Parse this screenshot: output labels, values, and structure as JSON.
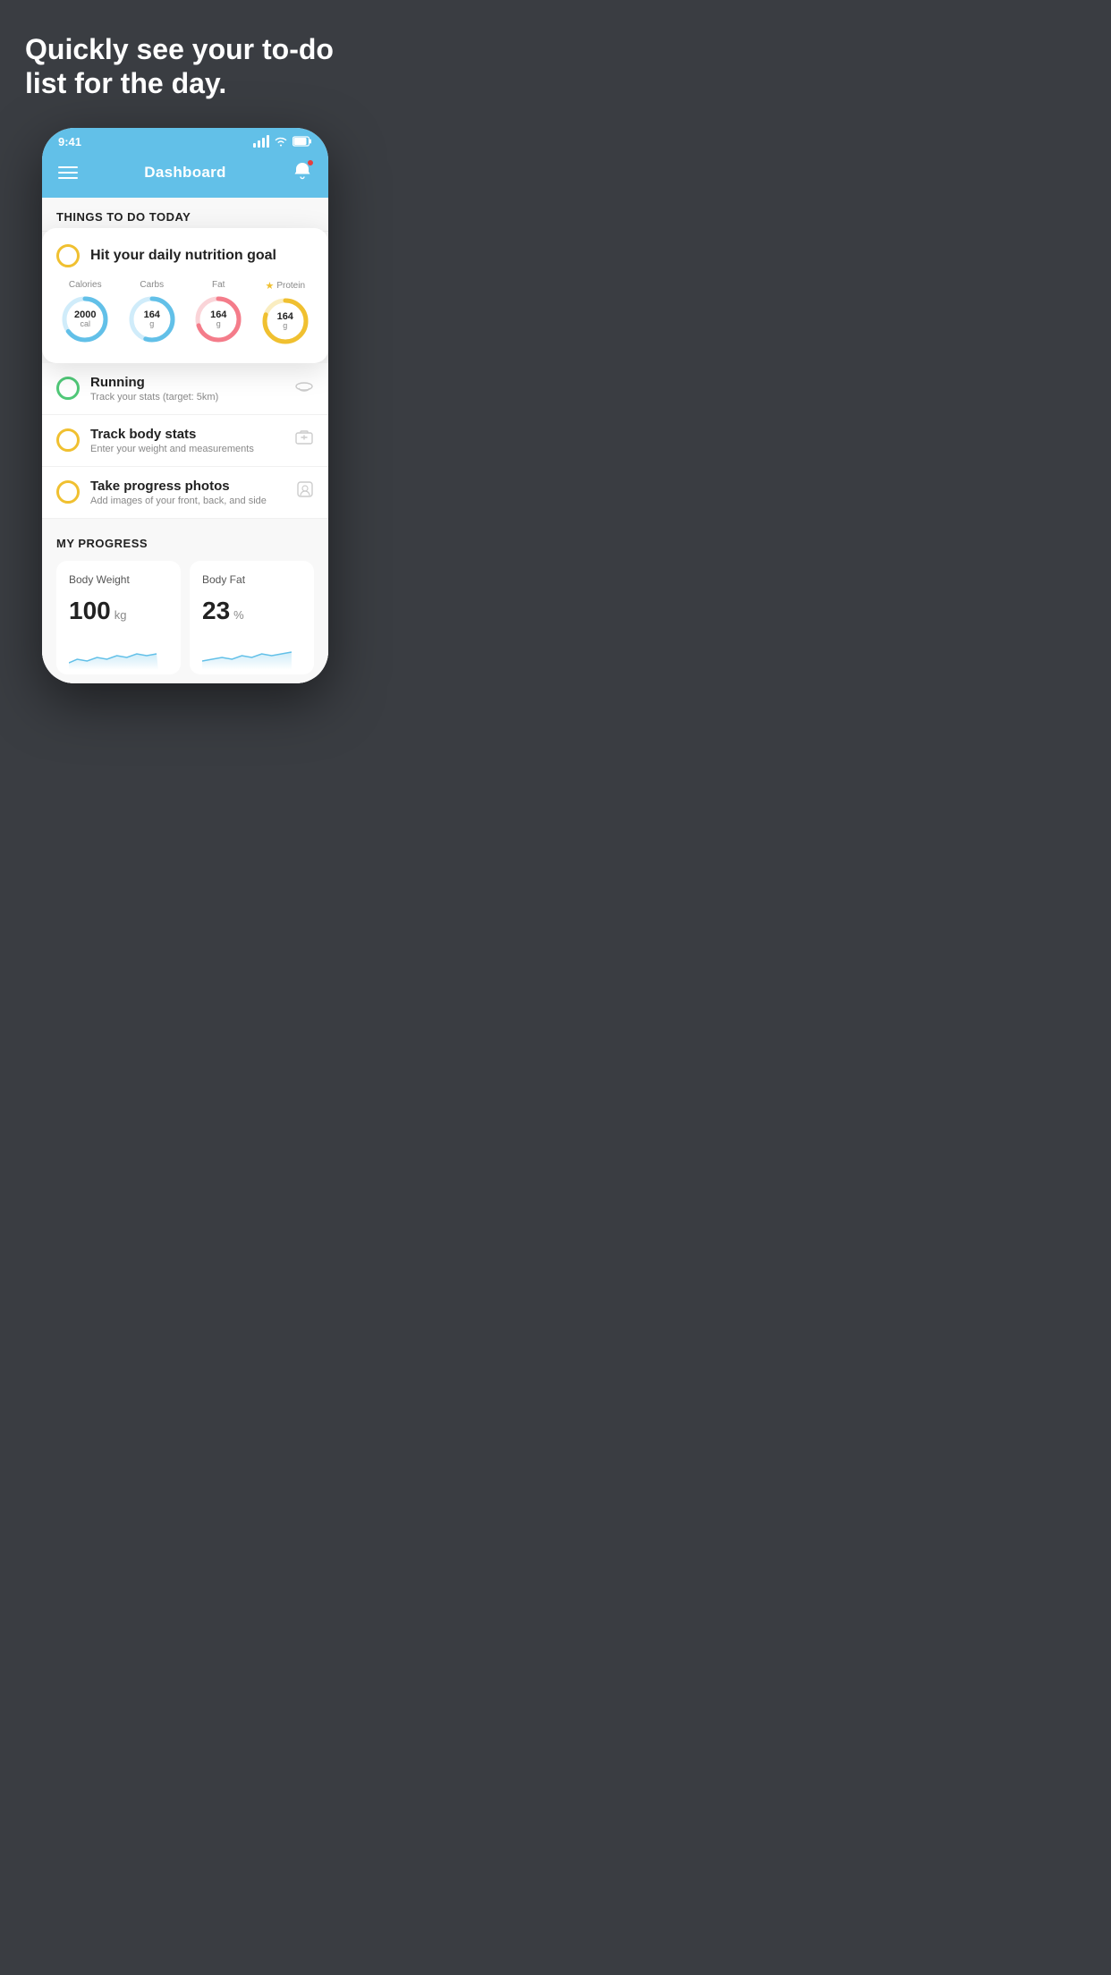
{
  "hero": {
    "title": "Quickly see your to-do list for the day."
  },
  "statusBar": {
    "time": "9:41"
  },
  "navBar": {
    "title": "Dashboard"
  },
  "todaySection": {
    "heading": "THINGS TO DO TODAY"
  },
  "nutritionCard": {
    "title": "Hit your daily nutrition goal",
    "circles": [
      {
        "label": "Calories",
        "value": "2000",
        "unit": "cal",
        "color": "#62c0e8",
        "trackColor": "#d0ecfa",
        "pct": 65
      },
      {
        "label": "Carbs",
        "value": "164",
        "unit": "g",
        "color": "#62c0e8",
        "trackColor": "#d0ecfa",
        "pct": 55
      },
      {
        "label": "Fat",
        "value": "164",
        "unit": "g",
        "color": "#f47c8a",
        "trackColor": "#fad4d8",
        "pct": 70
      },
      {
        "label": "Protein",
        "value": "164",
        "unit": "g",
        "color": "#f0c030",
        "trackColor": "#faedc0",
        "pct": 80,
        "star": true
      }
    ]
  },
  "todoList": [
    {
      "title": "Running",
      "sub": "Track your stats (target: 5km)",
      "checkColor": "#50c878",
      "icon": "👟"
    },
    {
      "title": "Track body stats",
      "sub": "Enter your weight and measurements",
      "checkColor": "#f0c030",
      "icon": "⊡"
    },
    {
      "title": "Take progress photos",
      "sub": "Add images of your front, back, and side",
      "checkColor": "#f0c030",
      "icon": "👤"
    }
  ],
  "progressSection": {
    "heading": "MY PROGRESS",
    "cards": [
      {
        "title": "Body Weight",
        "value": "100",
        "unit": "kg"
      },
      {
        "title": "Body Fat",
        "value": "23",
        "unit": "%"
      }
    ]
  }
}
